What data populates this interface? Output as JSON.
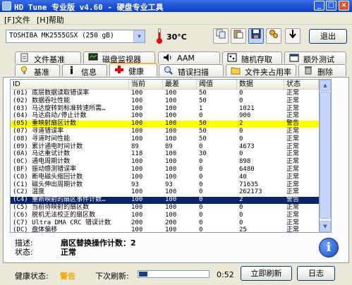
{
  "window": {
    "title": "HD Tune 专业版 v4.60 - 硬盘专业工具"
  },
  "menu": [
    "[F]文件",
    "[H]帮助"
  ],
  "toolbar": {
    "drive": "TOSHIBA MK2555GSX (250 gB)",
    "temperature": "30°C",
    "exit_label": "退出",
    "buttons": [
      "copy-icon",
      "paste-icon",
      "save-icon",
      "settings-icon",
      "download-icon"
    ]
  },
  "tabs_top": [
    {
      "label": "文件基准",
      "icon": "file-icon"
    },
    {
      "label": "磁盘监视器",
      "icon": "monitor-icon"
    },
    {
      "label": "AAM",
      "icon": "speaker-icon"
    },
    {
      "label": "随机存取",
      "icon": "random-access-icon"
    },
    {
      "label": "额外测试",
      "icon": "extra-tests-icon"
    }
  ],
  "tabs_bottom": [
    {
      "label": "基准",
      "icon": "benchmark-icon"
    },
    {
      "label": "信息",
      "icon": "info-icon"
    },
    {
      "label": "健康",
      "icon": "health-icon"
    },
    {
      "label": "错误扫描",
      "icon": "error-scan-icon"
    },
    {
      "label": "文件夹占用率",
      "icon": "folder-icon"
    },
    {
      "label": "删除",
      "icon": "delete-icon"
    }
  ],
  "columns": [
    "ID",
    "当前",
    "最差",
    "阈值",
    "数据",
    "状态"
  ],
  "rows": [
    {
      "id": "(01) 底层数据读取错误率",
      "cur": "100",
      "worst": "100",
      "thr": "50",
      "data": "0",
      "status": "正常",
      "hl": ""
    },
    {
      "id": "(02) 数据吞吐性能",
      "cur": "100",
      "worst": "100",
      "thr": "50",
      "data": "0",
      "status": "正常",
      "hl": ""
    },
    {
      "id": "(03) 马达旋转到标准转速所需…",
      "cur": "100",
      "worst": "100",
      "thr": "1",
      "data": "1021",
      "status": "正常",
      "hl": ""
    },
    {
      "id": "(04) 马达启动/停止计数",
      "cur": "100",
      "worst": "100",
      "thr": "0",
      "data": "900",
      "status": "正常",
      "hl": ""
    },
    {
      "id": "(05) 重映射扇区计数",
      "cur": "100",
      "worst": "100",
      "thr": "50",
      "data": "2",
      "status": "警告",
      "hl": "warn"
    },
    {
      "id": "(07) 寻道错误率",
      "cur": "100",
      "worst": "100",
      "thr": "50",
      "data": "0",
      "status": "正常",
      "hl": ""
    },
    {
      "id": "(08) 寻道时间性能",
      "cur": "100",
      "worst": "100",
      "thr": "50",
      "data": "0",
      "status": "正常",
      "hl": ""
    },
    {
      "id": "(09) 累计通电时间计数",
      "cur": "89",
      "worst": "89",
      "thr": "0",
      "data": "4673",
      "status": "正常",
      "hl": ""
    },
    {
      "id": "(0A) 马达重试计数",
      "cur": "118",
      "worst": "100",
      "thr": "30",
      "data": "0",
      "status": "正常",
      "hl": ""
    },
    {
      "id": "(0C) 通电周期计数",
      "cur": "100",
      "worst": "100",
      "thr": "0",
      "data": "898",
      "status": "正常",
      "hl": ""
    },
    {
      "id": "(BF) 振动感测错误率",
      "cur": "100",
      "worst": "100",
      "thr": "0",
      "data": "6480",
      "status": "正常",
      "hl": ""
    },
    {
      "id": "(C0) 断电磁头缩回计数",
      "cur": "100",
      "worst": "100",
      "thr": "0",
      "data": "40",
      "status": "正常",
      "hl": ""
    },
    {
      "id": "(C1) 磁头伸出周期计数",
      "cur": "93",
      "worst": "93",
      "thr": "0",
      "data": "71635",
      "status": "正常",
      "hl": ""
    },
    {
      "id": "(C2) 温度",
      "cur": "100",
      "worst": "100",
      "thr": "0",
      "data": "262173",
      "status": "正常",
      "hl": ""
    },
    {
      "id": "(C4) 重新映射的扇区事件计数…",
      "cur": "100",
      "worst": "100",
      "thr": "0",
      "data": "2",
      "status": "警告",
      "hl": "sel"
    },
    {
      "id": "(C5) 当前待映射的扇区数",
      "cur": "100",
      "worst": "100",
      "thr": "0",
      "data": "0",
      "status": "正常",
      "hl": ""
    },
    {
      "id": "(C6) 脱机无法校正的扇区数",
      "cur": "100",
      "worst": "100",
      "thr": "0",
      "data": "0",
      "status": "正常",
      "hl": ""
    },
    {
      "id": "(C7) Ultra DMA CRC 错误计数",
      "cur": "200",
      "worst": "200",
      "thr": "0",
      "data": "0",
      "status": "正常",
      "hl": ""
    },
    {
      "id": "(DC) 盘体偏移",
      "cur": "100",
      "worst": "100",
      "thr": "0",
      "data": "25",
      "status": "正常",
      "hl": ""
    }
  ],
  "detail": {
    "desc_label": "描述:",
    "desc_value": "扇区替换操作计数：2",
    "state_label": "状态:",
    "state_value": "正常"
  },
  "status": {
    "health_label": "健康状态:",
    "health_value": "警告",
    "next_refresh_label": "下次刷新:",
    "countdown": "0:52",
    "refresh_progress": 0.12,
    "refresh_button": "立即刷新",
    "log_button": "日志"
  },
  "colors": {
    "warning_row": "#ffff00",
    "selected_row": "#0a246a",
    "warning_text": "#f5a800"
  }
}
